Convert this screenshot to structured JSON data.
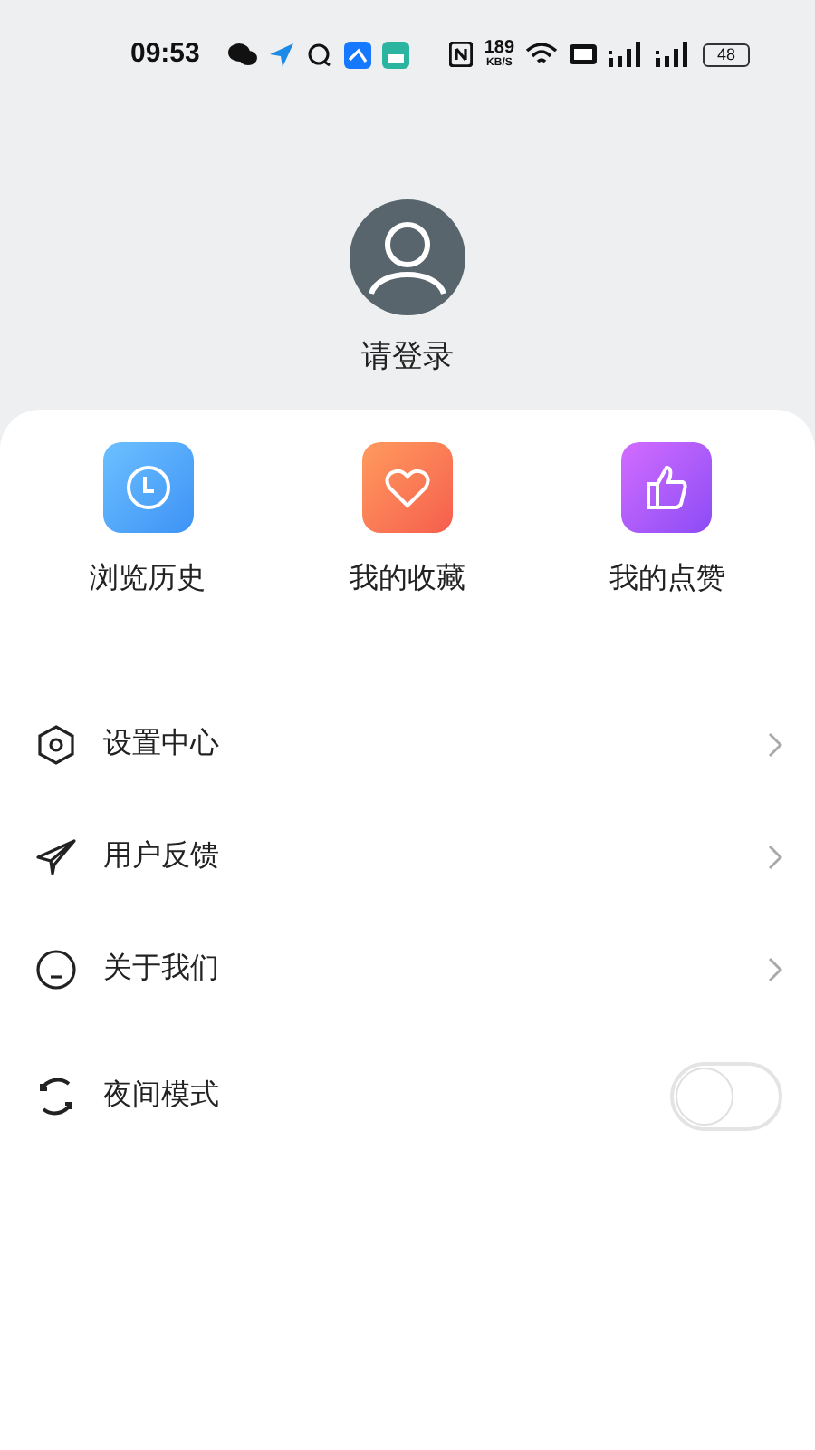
{
  "status_bar": {
    "time": "09:53",
    "network_speed": "189",
    "network_speed_unit": "KB/S",
    "battery": "48"
  },
  "profile": {
    "login_label": "请登录"
  },
  "shortcuts": [
    {
      "label": "浏览历史"
    },
    {
      "label": "我的收藏"
    },
    {
      "label": "我的点赞"
    }
  ],
  "menu": [
    {
      "kind": "link",
      "label": "设置中心"
    },
    {
      "kind": "link",
      "label": "用户反馈"
    },
    {
      "kind": "link",
      "label": "关于我们"
    },
    {
      "kind": "toggle",
      "label": "夜间模式",
      "on": false
    }
  ]
}
